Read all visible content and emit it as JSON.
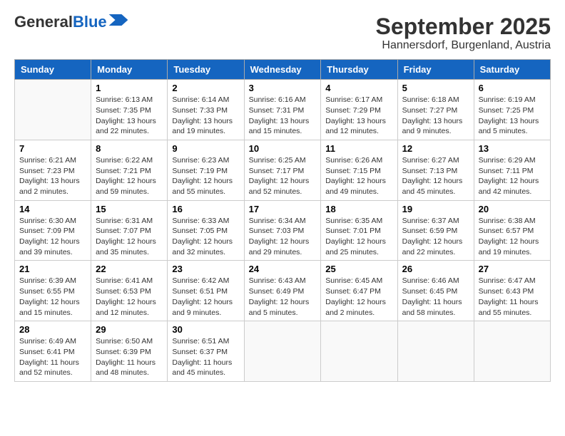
{
  "logo": {
    "line1": "General",
    "line2": "Blue"
  },
  "title": "September 2025",
  "subtitle": "Hannersdorf, Burgenland, Austria",
  "days_of_week": [
    "Sunday",
    "Monday",
    "Tuesday",
    "Wednesday",
    "Thursday",
    "Friday",
    "Saturday"
  ],
  "weeks": [
    [
      {
        "day": "",
        "info": ""
      },
      {
        "day": "1",
        "info": "Sunrise: 6:13 AM\nSunset: 7:35 PM\nDaylight: 13 hours\nand 22 minutes."
      },
      {
        "day": "2",
        "info": "Sunrise: 6:14 AM\nSunset: 7:33 PM\nDaylight: 13 hours\nand 19 minutes."
      },
      {
        "day": "3",
        "info": "Sunrise: 6:16 AM\nSunset: 7:31 PM\nDaylight: 13 hours\nand 15 minutes."
      },
      {
        "day": "4",
        "info": "Sunrise: 6:17 AM\nSunset: 7:29 PM\nDaylight: 13 hours\nand 12 minutes."
      },
      {
        "day": "5",
        "info": "Sunrise: 6:18 AM\nSunset: 7:27 PM\nDaylight: 13 hours\nand 9 minutes."
      },
      {
        "day": "6",
        "info": "Sunrise: 6:19 AM\nSunset: 7:25 PM\nDaylight: 13 hours\nand 5 minutes."
      }
    ],
    [
      {
        "day": "7",
        "info": "Sunrise: 6:21 AM\nSunset: 7:23 PM\nDaylight: 13 hours\nand 2 minutes."
      },
      {
        "day": "8",
        "info": "Sunrise: 6:22 AM\nSunset: 7:21 PM\nDaylight: 12 hours\nand 59 minutes."
      },
      {
        "day": "9",
        "info": "Sunrise: 6:23 AM\nSunset: 7:19 PM\nDaylight: 12 hours\nand 55 minutes."
      },
      {
        "day": "10",
        "info": "Sunrise: 6:25 AM\nSunset: 7:17 PM\nDaylight: 12 hours\nand 52 minutes."
      },
      {
        "day": "11",
        "info": "Sunrise: 6:26 AM\nSunset: 7:15 PM\nDaylight: 12 hours\nand 49 minutes."
      },
      {
        "day": "12",
        "info": "Sunrise: 6:27 AM\nSunset: 7:13 PM\nDaylight: 12 hours\nand 45 minutes."
      },
      {
        "day": "13",
        "info": "Sunrise: 6:29 AM\nSunset: 7:11 PM\nDaylight: 12 hours\nand 42 minutes."
      }
    ],
    [
      {
        "day": "14",
        "info": "Sunrise: 6:30 AM\nSunset: 7:09 PM\nDaylight: 12 hours\nand 39 minutes."
      },
      {
        "day": "15",
        "info": "Sunrise: 6:31 AM\nSunset: 7:07 PM\nDaylight: 12 hours\nand 35 minutes."
      },
      {
        "day": "16",
        "info": "Sunrise: 6:33 AM\nSunset: 7:05 PM\nDaylight: 12 hours\nand 32 minutes."
      },
      {
        "day": "17",
        "info": "Sunrise: 6:34 AM\nSunset: 7:03 PM\nDaylight: 12 hours\nand 29 minutes."
      },
      {
        "day": "18",
        "info": "Sunrise: 6:35 AM\nSunset: 7:01 PM\nDaylight: 12 hours\nand 25 minutes."
      },
      {
        "day": "19",
        "info": "Sunrise: 6:37 AM\nSunset: 6:59 PM\nDaylight: 12 hours\nand 22 minutes."
      },
      {
        "day": "20",
        "info": "Sunrise: 6:38 AM\nSunset: 6:57 PM\nDaylight: 12 hours\nand 19 minutes."
      }
    ],
    [
      {
        "day": "21",
        "info": "Sunrise: 6:39 AM\nSunset: 6:55 PM\nDaylight: 12 hours\nand 15 minutes."
      },
      {
        "day": "22",
        "info": "Sunrise: 6:41 AM\nSunset: 6:53 PM\nDaylight: 12 hours\nand 12 minutes."
      },
      {
        "day": "23",
        "info": "Sunrise: 6:42 AM\nSunset: 6:51 PM\nDaylight: 12 hours\nand 9 minutes."
      },
      {
        "day": "24",
        "info": "Sunrise: 6:43 AM\nSunset: 6:49 PM\nDaylight: 12 hours\nand 5 minutes."
      },
      {
        "day": "25",
        "info": "Sunrise: 6:45 AM\nSunset: 6:47 PM\nDaylight: 12 hours\nand 2 minutes."
      },
      {
        "day": "26",
        "info": "Sunrise: 6:46 AM\nSunset: 6:45 PM\nDaylight: 11 hours\nand 58 minutes."
      },
      {
        "day": "27",
        "info": "Sunrise: 6:47 AM\nSunset: 6:43 PM\nDaylight: 11 hours\nand 55 minutes."
      }
    ],
    [
      {
        "day": "28",
        "info": "Sunrise: 6:49 AM\nSunset: 6:41 PM\nDaylight: 11 hours\nand 52 minutes."
      },
      {
        "day": "29",
        "info": "Sunrise: 6:50 AM\nSunset: 6:39 PM\nDaylight: 11 hours\nand 48 minutes."
      },
      {
        "day": "30",
        "info": "Sunrise: 6:51 AM\nSunset: 6:37 PM\nDaylight: 11 hours\nand 45 minutes."
      },
      {
        "day": "",
        "info": ""
      },
      {
        "day": "",
        "info": ""
      },
      {
        "day": "",
        "info": ""
      },
      {
        "day": "",
        "info": ""
      }
    ]
  ]
}
